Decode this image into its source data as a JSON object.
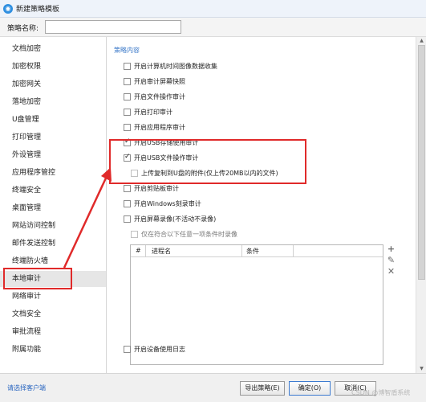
{
  "window": {
    "title": "新建策略模板",
    "icon": "app-logo-icon"
  },
  "policy_name": {
    "label": "策略名称:",
    "value": ""
  },
  "sidebar": {
    "items": [
      {
        "label": "文档加密"
      },
      {
        "label": "加密权限"
      },
      {
        "label": "加密网关"
      },
      {
        "label": "落地加密"
      },
      {
        "label": "U盘管理"
      },
      {
        "label": "打印管理"
      },
      {
        "label": "外设管理"
      },
      {
        "label": "应用程序管控"
      },
      {
        "label": "终端安全"
      },
      {
        "label": "桌面管理"
      },
      {
        "label": "网站访问控制"
      },
      {
        "label": "邮件发送控制"
      },
      {
        "label": "终端防火墙"
      },
      {
        "label": "本地审计",
        "selected": true
      },
      {
        "label": "网络审计"
      },
      {
        "label": "文档安全"
      },
      {
        "label": "审批流程"
      },
      {
        "label": "附属功能"
      }
    ]
  },
  "content": {
    "section_title": "策略内容",
    "options": [
      {
        "label": "开启计算机时间图像数据收集",
        "checked": false
      },
      {
        "label": "开启审计屏幕快照",
        "checked": false
      },
      {
        "label": "开启文件操作审计",
        "checked": false
      },
      {
        "label": "开启打印审计",
        "checked": false
      },
      {
        "label": "开启应用程序审计",
        "checked": false
      },
      {
        "label": "开启USB存储使用审计",
        "checked": true
      },
      {
        "label": "开启USB文件操作审计",
        "checked": true
      },
      {
        "label": "上传复制到U盘的附件(仅上传20MB以内的文件)",
        "checked": false,
        "sub": true
      },
      {
        "label": "开启剪贴板审计",
        "checked": false
      },
      {
        "label": "开启Windows刻录审计",
        "checked": false
      },
      {
        "label": "开启屏幕录像(不活动不录像)",
        "checked": false
      }
    ],
    "screen_record_sub": {
      "label": "仅在符合以下任意一项条件时录像",
      "checked": false
    },
    "grid": {
      "columns": [
        "#",
        "进程名",
        "条件"
      ]
    },
    "grid_tools": {
      "add": "add-icon",
      "edit": "edit-icon",
      "delete": "delete-icon"
    },
    "device_audit": {
      "label": "开启设备使用日志",
      "checked": false
    }
  },
  "footer": {
    "link": "请选择客户端",
    "buttons": {
      "export": "导出策略(E)",
      "ok": "确定(O)",
      "cancel": "取消(C)"
    },
    "watermark": "CSDN @博智盾系统"
  },
  "colors": {
    "highlight": "#e02a2a",
    "link": "#2a66c0",
    "section": "#3a78c8"
  }
}
